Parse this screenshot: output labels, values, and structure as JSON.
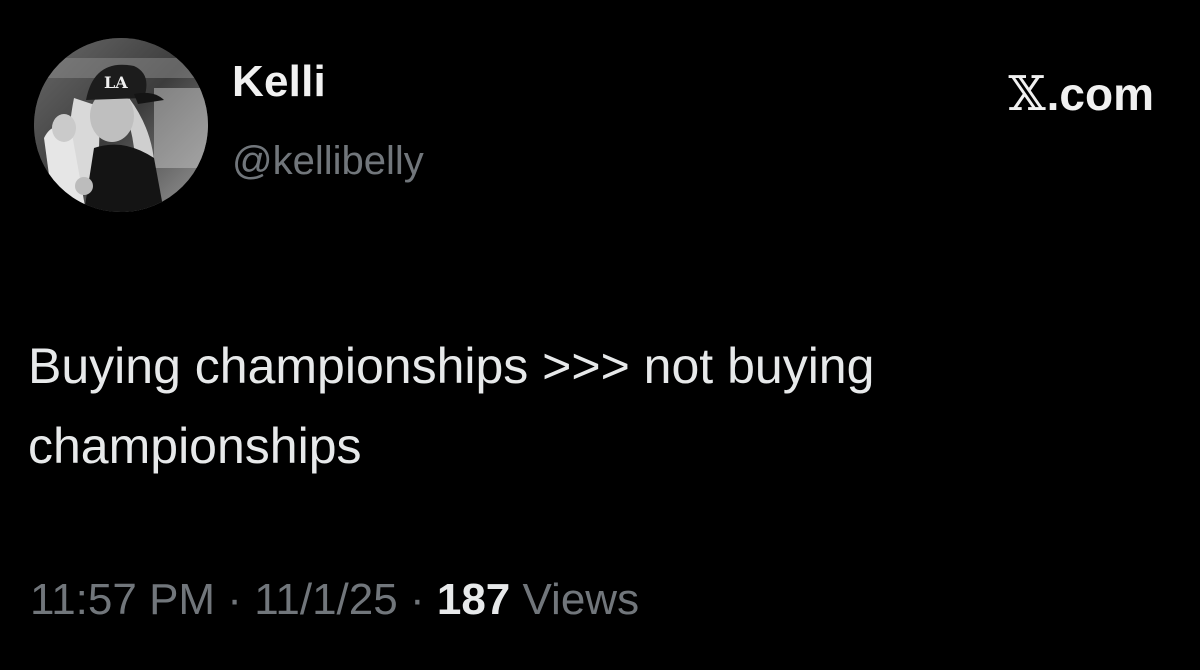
{
  "author": {
    "display_name": "Kelli",
    "handle": "@kellibelly",
    "avatar_icon": "profile-photo"
  },
  "brand": {
    "x_glyph": "𝕏",
    "domain": ".com"
  },
  "tweet": {
    "text": "Buying championships >>> not buying championships"
  },
  "meta": {
    "time": "11:57 PM",
    "separator_1": " · ",
    "date": "11/1/25",
    "separator_2": " · ",
    "views_count": "187",
    "views_label": " Views"
  },
  "colors": {
    "background": "#000000",
    "primary_text": "#e7e9ea",
    "secondary_text": "#71767b"
  }
}
